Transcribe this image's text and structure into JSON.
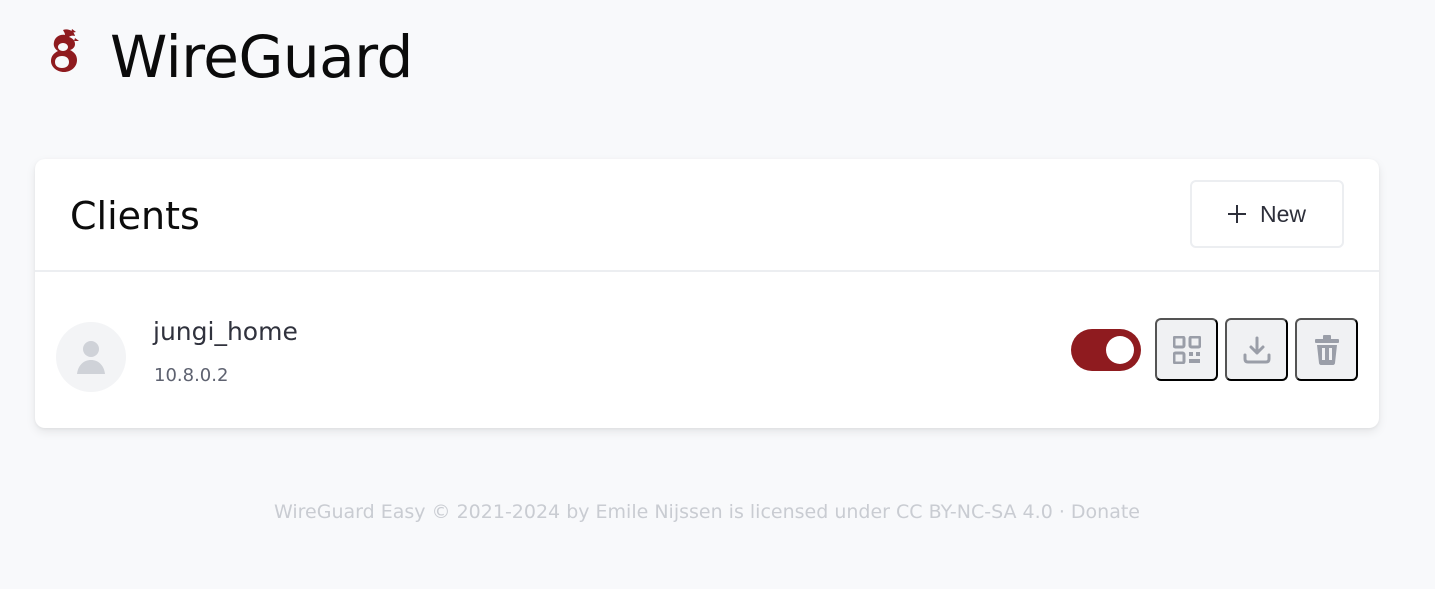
{
  "header": {
    "app_title": "WireGuard",
    "logo_icon": "wireguard-dragon-logo-icon",
    "brand_color": "#8f1b1f"
  },
  "clients_card": {
    "title": "Clients",
    "new_button": {
      "label": "New",
      "icon": "plus-icon"
    },
    "clients": [
      {
        "name": "jungi_home",
        "address": "10.8.0.2",
        "avatar_icon": "user-icon",
        "enabled": true,
        "actions": [
          {
            "name": "show-qr-code",
            "icon": "qr-code-icon"
          },
          {
            "name": "download-config",
            "icon": "download-icon"
          },
          {
            "name": "delete-client",
            "icon": "trash-icon"
          }
        ]
      }
    ]
  },
  "footer": {
    "text": "WireGuard Easy © 2021-2024 by Emile Nijssen is licensed under CC BY-NC-SA 4.0",
    "separator": " · ",
    "donate_label": "Donate"
  },
  "colors": {
    "page_background": "#f8f9fb",
    "toggle_on": "#8f1b1f",
    "action_button_bg": "#f0f1f3",
    "icon_gray": "#9a9ea8",
    "footer_text": "#c9ccd2"
  }
}
